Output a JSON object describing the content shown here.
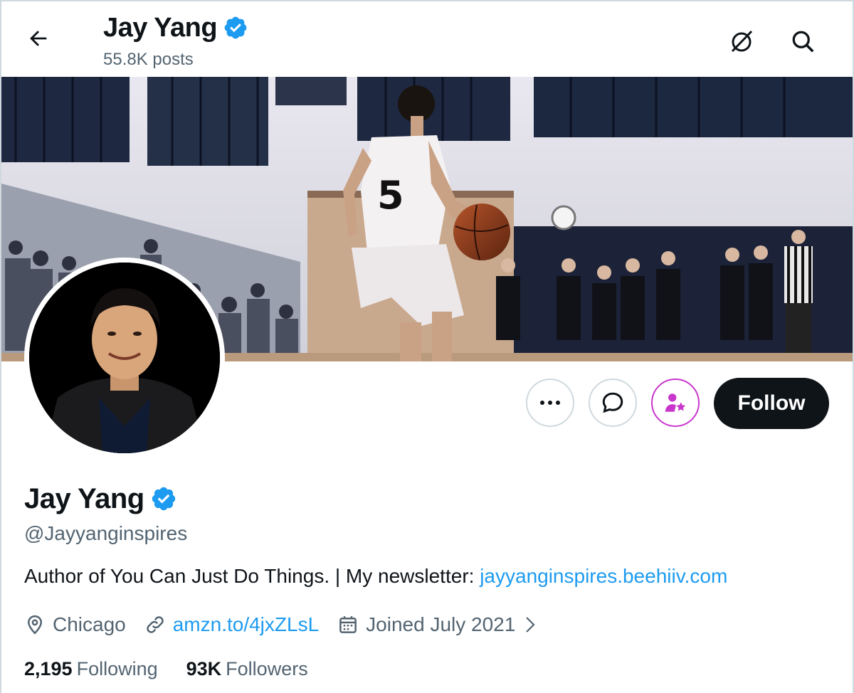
{
  "header": {
    "title": "Jay Yang",
    "posts_count": "55.8K posts",
    "back_icon": "arrow-left-icon",
    "grok_icon": "grok-icon",
    "search_icon": "search-icon"
  },
  "banner": {
    "description_icon": "banner-photo",
    "jersey_number": "5"
  },
  "profile": {
    "name": "Jay Yang",
    "handle": "@Jayyanginspires",
    "verified_color": "#1d9bf0",
    "bio_text": "Author of You Can Just Do Things. | My newsletter: ",
    "bio_link": "jayyanginspires.beehiiv.com",
    "location": "Chicago",
    "website": "amzn.to/4jxZLsL",
    "joined": "Joined July 2021",
    "following_count": "2,195",
    "following_label": "Following",
    "followers_count": "93K",
    "followers_label": "Followers"
  },
  "actions": {
    "more_icon": "more-icon",
    "message_icon": "message-icon",
    "subscribe_icon": "subscribe-icon",
    "follow_label": "Follow"
  },
  "colors": {
    "link": "#1d9bf0",
    "secondary_text": "#536471",
    "primary_text": "#0f1419",
    "subscribe_accent": "#c936cc"
  }
}
